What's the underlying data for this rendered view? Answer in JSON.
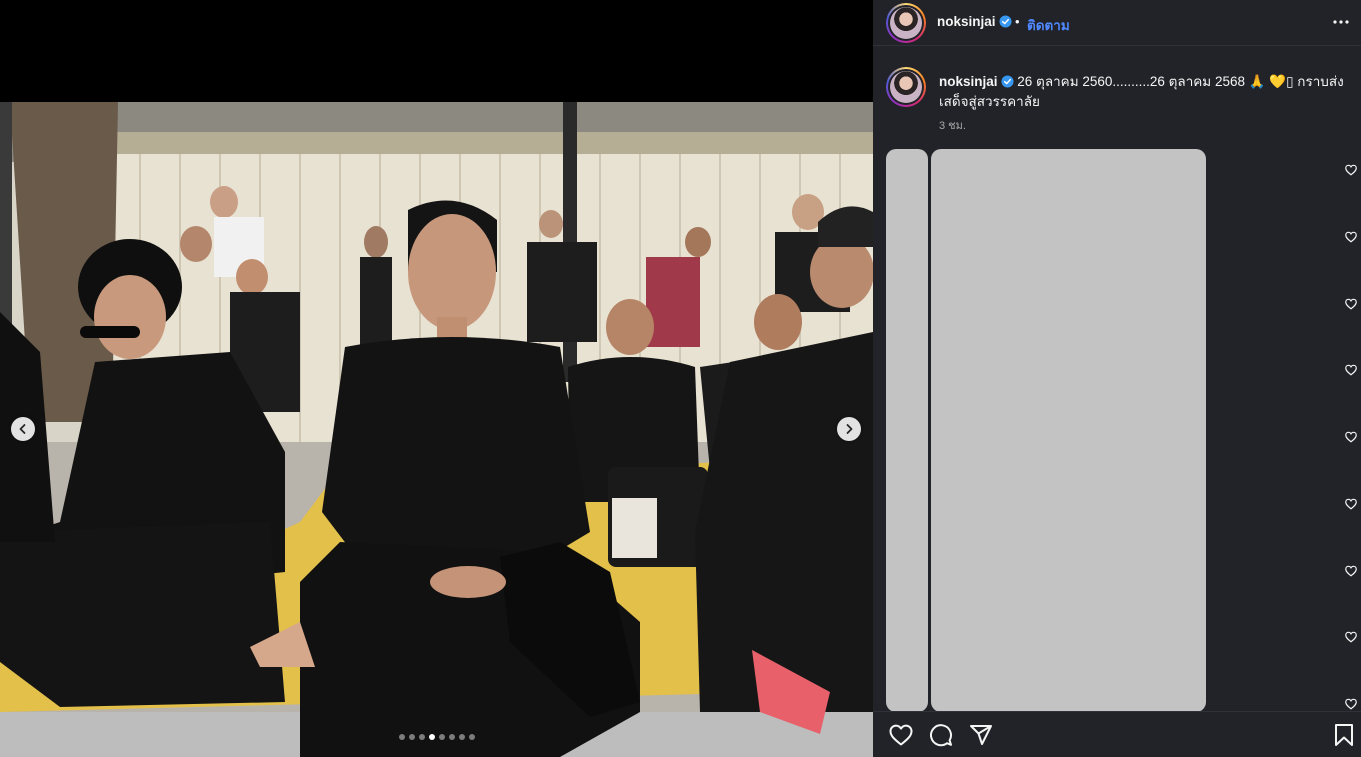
{
  "post": {
    "username": "noksinjai",
    "separator": "•",
    "follow_label": "ติดตาม",
    "caption_text": "26 ตุลาคม 2560..........26 ตุลาคม 2568 🙏 💛▯ กราบส่งเสด็จสู่สวรรคาลัย",
    "time_ago": "3 ชม."
  },
  "carousel": {
    "slide_count": 8,
    "active_index": 3
  },
  "icons": {
    "verified": "verified-badge-icon",
    "more": "more-options-icon",
    "prev": "chevron-left-icon",
    "next": "chevron-right-icon",
    "like": "heart-icon",
    "comment": "comment-bubble-icon",
    "share": "paper-plane-icon",
    "save": "bookmark-icon"
  },
  "colors": {
    "follow_link": "#4f88ff",
    "verified_badge": "#3897f0",
    "panel_bg": "#212328",
    "placeholder": "#c3c3c3"
  }
}
